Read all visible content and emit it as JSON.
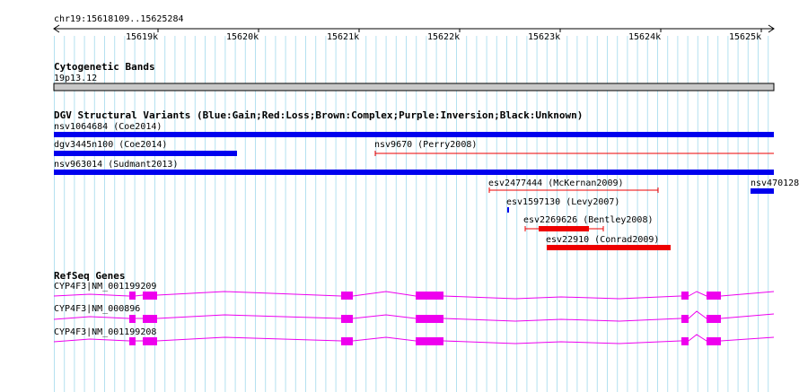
{
  "region": {
    "label": "chr19:15618109..15625284",
    "ticks": [
      "15619k",
      "15620k",
      "15621k",
      "15622k",
      "15623k",
      "15624k",
      "15625k"
    ]
  },
  "cytoband": {
    "title": "Cytogenetic Bands",
    "band": "19p13.12"
  },
  "dgv": {
    "title": "DGV Structural Variants (Blue:Gain;Red:Loss;Brown:Complex;Purple:Inversion;Black:Unknown)",
    "features": [
      {
        "label": "nsv1064684 (Coe2014)",
        "type": "gain"
      },
      {
        "label": "dgv3445n100 (Coe2014)",
        "type": "gain"
      },
      {
        "label": "nsv9670 (Perry2008)",
        "type": "loss"
      },
      {
        "label": "nsv963014 (Sudmant2013)",
        "type": "gain"
      },
      {
        "label": "esv2477444 (McKernan2009)",
        "type": "loss"
      },
      {
        "label": "nsv470128",
        "type": "gain"
      },
      {
        "label": "esv1597130 (Levy2007)",
        "type": "gain"
      },
      {
        "label": "esv2269626 (Bentley2008)",
        "type": "loss"
      },
      {
        "label": "esv22910 (Conrad2009)",
        "type": "loss"
      }
    ]
  },
  "refseq": {
    "title": "RefSeq Genes",
    "transcripts": [
      {
        "label": "CYP4F3|NM_001199209"
      },
      {
        "label": "CYP4F3|NM_000896"
      },
      {
        "label": "CYP4F3|NM_001199208"
      }
    ]
  },
  "colors": {
    "gain": "#0000ee",
    "loss": "#ee0000",
    "gene": "#ee00ee",
    "grid": "#b4e1f0",
    "band": "#c8c8c8"
  }
}
